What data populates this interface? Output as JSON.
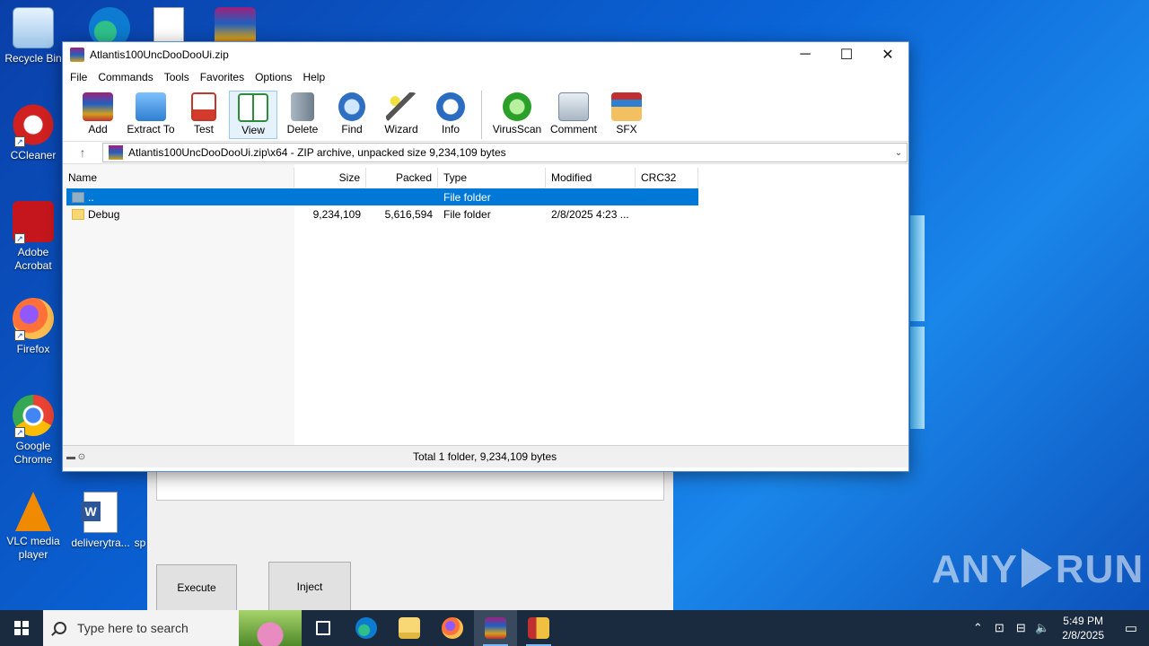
{
  "desktop": {
    "icons": [
      {
        "label": "Recycle Bin"
      },
      {
        "label": "CCleaner"
      },
      {
        "label": "Adobe Acrobat"
      },
      {
        "label": "Firefox"
      },
      {
        "label": "Google Chrome"
      },
      {
        "label": "VLC media player"
      },
      {
        "label": "deliverytra..."
      },
      {
        "label": "sp"
      }
    ],
    "watermark": {
      "left": "ANY",
      "right": "RUN"
    }
  },
  "background_app": {
    "execute_label": "Execute",
    "inject_label": "Inject"
  },
  "window": {
    "title": "Atlantis100UncDooDooUi.zip",
    "controls": {
      "minimize": "─",
      "maximize": "☐",
      "close": "✕"
    },
    "menu": [
      "File",
      "Commands",
      "Tools",
      "Favorites",
      "Options",
      "Help"
    ],
    "toolbar": [
      {
        "label": "Add",
        "color": "#c0392b"
      },
      {
        "label": "Extract To",
        "color": "#3b8fd9"
      },
      {
        "label": "Test",
        "color": "#d33b2c"
      },
      {
        "label": "View",
        "color": "#2e8b3a"
      },
      {
        "label": "Delete",
        "color": "#8a9aa8"
      },
      {
        "label": "Find",
        "color": "#2f6fc2"
      },
      {
        "label": "Wizard",
        "color": "#5aa02c"
      },
      {
        "label": "Info",
        "color": "#2a6cc0"
      },
      {
        "label": "VirusScan",
        "color": "#2aa02a"
      },
      {
        "label": "Comment",
        "color": "#7a8a9a"
      },
      {
        "label": "SFX",
        "color": "#e0a030"
      }
    ],
    "address": {
      "up_icon": "↑",
      "path": "Atlantis100UncDooDooUi.zip\\x64 - ZIP archive, unpacked size 9,234,109 bytes",
      "dropdown_icon": "⌄"
    },
    "columns": [
      "Name",
      "Size",
      "Packed",
      "Type",
      "Modified",
      "CRC32"
    ],
    "rows": [
      {
        "name": "..",
        "size": "",
        "packed": "",
        "type": "File folder",
        "modified": "",
        "crc": ""
      },
      {
        "name": "Debug",
        "size": "9,234,109",
        "packed": "5,616,594",
        "type": "File folder",
        "modified": "2/8/2025 4:23 ...",
        "crc": ""
      }
    ],
    "status": "Total 1 folder, 9,234,109 bytes"
  },
  "taskbar": {
    "search_placeholder": "Type here to search",
    "time": "5:49 PM",
    "date": "2/8/2025"
  }
}
